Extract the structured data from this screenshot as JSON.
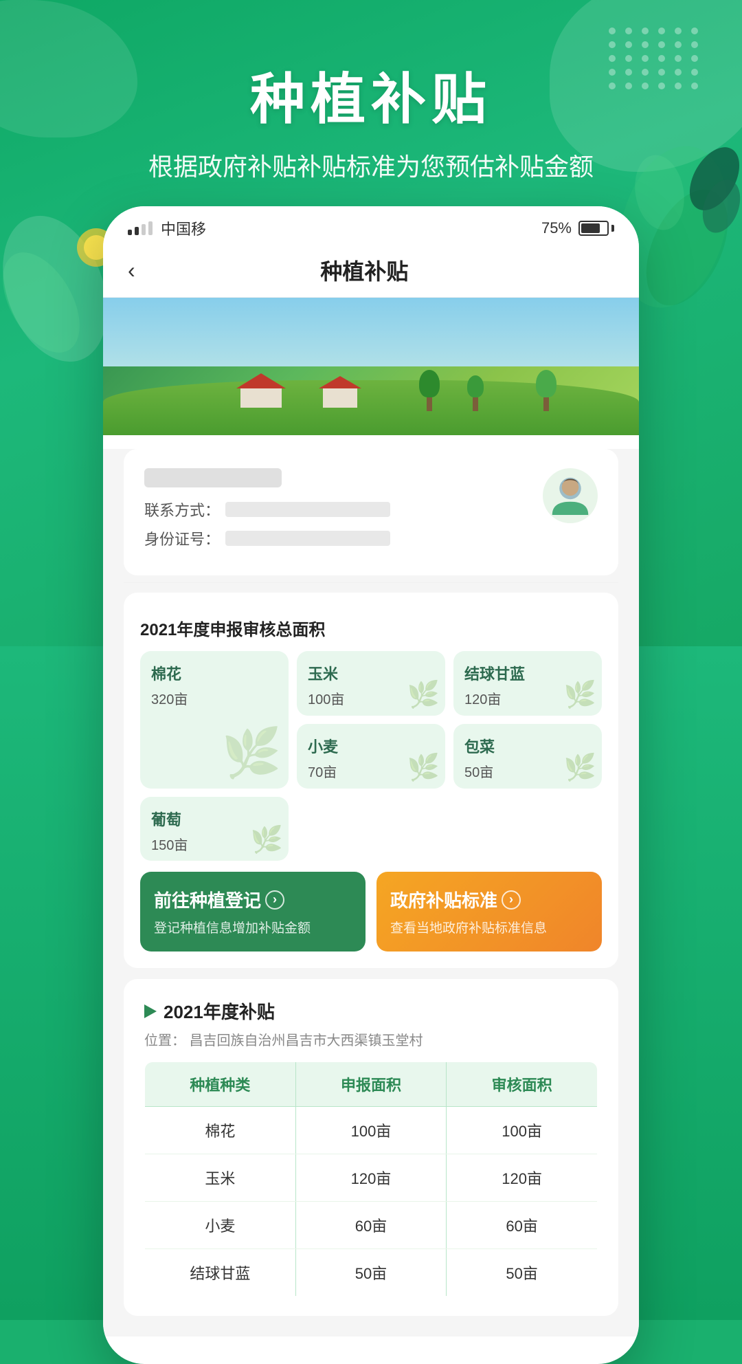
{
  "app": {
    "title": "种植补贴",
    "subtitle": "根据政府补贴补贴标准为您预估补贴金额"
  },
  "statusBar": {
    "carrier": "中国移",
    "battery": "75%",
    "signalDots": 4
  },
  "nav": {
    "back_label": "‹",
    "title": "种植补贴"
  },
  "userCard": {
    "contact_label": "联系方式：",
    "id_label": "身份证号："
  },
  "cropStats": {
    "section_title": "2021年度申报审核总面积",
    "crops": [
      {
        "name": "棉花",
        "area": "320亩",
        "large": true
      },
      {
        "name": "玉米",
        "area": "100亩",
        "large": false
      },
      {
        "name": "结球甘蓝",
        "area": "120亩",
        "large": false
      },
      {
        "name": "小麦",
        "area": "70亩",
        "large": false
      },
      {
        "name": "包菜",
        "area": "50亩",
        "large": false
      },
      {
        "name": "葡萄",
        "area": "150亩",
        "large": false
      }
    ]
  },
  "actions": {
    "register": {
      "title": "前往种植登记",
      "desc": "登记种植信息增加补贴金额",
      "arrow": "›"
    },
    "standard": {
      "title": "政府补贴标准",
      "desc": "查看当地政府补贴标准信息",
      "arrow": "›"
    }
  },
  "subsidy": {
    "section_title": "2021年度补贴",
    "location_label": "位置：",
    "location": "昌吉回族自治州昌吉市大西渠镇玉堂村",
    "table": {
      "headers": [
        "种植种类",
        "申报面积",
        "审核面积"
      ],
      "rows": [
        {
          "crop": "棉花",
          "reported": "100亩",
          "approved": "100亩"
        },
        {
          "crop": "玉米",
          "reported": "120亩",
          "approved": "120亩"
        },
        {
          "crop": "小麦",
          "reported": "60亩",
          "approved": "60亩"
        },
        {
          "crop": "结球甘蓝",
          "reported": "50亩",
          "approved": "50亩"
        }
      ]
    }
  },
  "colors": {
    "primary_green": "#2d8a55",
    "light_green_bg": "#e8f7ed",
    "orange": "#f5a623",
    "text_dark": "#222222",
    "text_mid": "#555555"
  }
}
